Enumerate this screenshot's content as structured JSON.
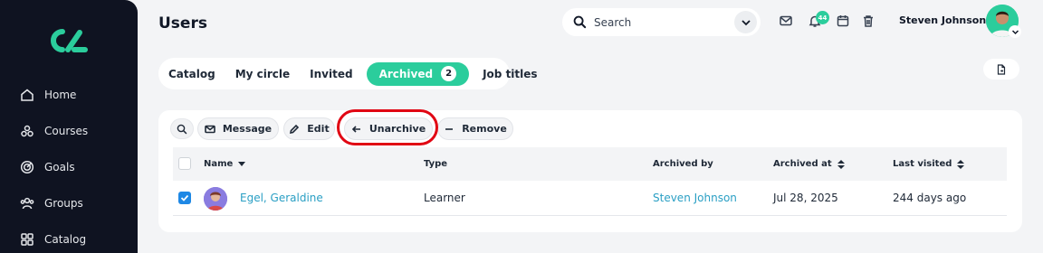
{
  "sidebar": {
    "items": [
      {
        "label": "Home",
        "icon": "home-icon"
      },
      {
        "label": "Courses",
        "icon": "courses-icon"
      },
      {
        "label": "Goals",
        "icon": "target-icon"
      },
      {
        "label": "Groups",
        "icon": "groups-icon"
      },
      {
        "label": "Catalog",
        "icon": "grid-icon"
      }
    ]
  },
  "header": {
    "title": "Users",
    "search_placeholder": "Search",
    "notification_count": "44",
    "user_name": "Steven Johnson"
  },
  "tabs": [
    {
      "label": "Catalog"
    },
    {
      "label": "My circle"
    },
    {
      "label": "Invited"
    },
    {
      "label": "Archived",
      "count": "2",
      "active": true
    },
    {
      "label": "Job titles"
    }
  ],
  "toolbar": {
    "message": "Message",
    "edit": "Edit",
    "unarchive": "Unarchive",
    "remove": "Remove"
  },
  "table": {
    "columns": [
      "Name",
      "Type",
      "Archived by",
      "Archived at",
      "Last visited"
    ],
    "rows": [
      {
        "name": "Egel, Geraldine",
        "type": "Learner",
        "archived_by": "Steven Johnson",
        "archived_at": "Jul 28, 2025",
        "last_visited": "244 days ago",
        "checked": true
      }
    ]
  },
  "colors": {
    "accent": "#2bcd9c",
    "sidebar": "#0f1321",
    "link": "#2a9fc4",
    "highlight": "#e10613",
    "checkbox": "#1e88e5"
  }
}
